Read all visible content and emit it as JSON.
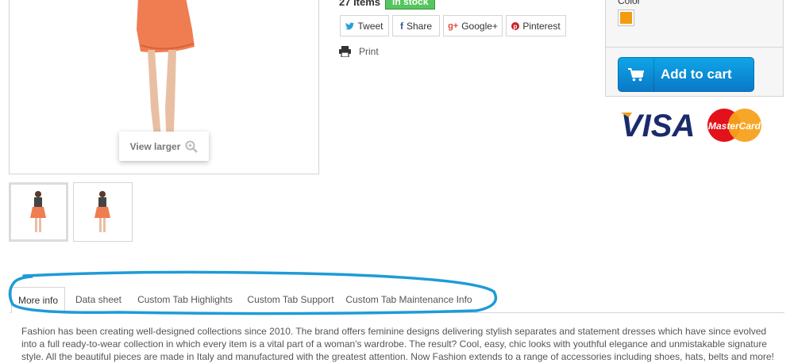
{
  "stock": {
    "quantity_text": "27 Items",
    "status_badge": "In stock"
  },
  "share": {
    "tweet": "Tweet",
    "share": "Share",
    "google": "Google+",
    "pinterest": "Pinterest"
  },
  "print_label": "Print",
  "image": {
    "view_larger": "View larger"
  },
  "buy_box": {
    "color_label": "Color",
    "selected_color": "#f39c11",
    "add_to_cart": "Add to cart",
    "payment_logos": [
      "VISA",
      "MasterCard"
    ]
  },
  "tabs": [
    {
      "label": "More info",
      "active": true
    },
    {
      "label": "Data sheet",
      "active": false
    },
    {
      "label": "Custom Tab Highlights",
      "active": false
    },
    {
      "label": "Custom Tab Support",
      "active": false
    },
    {
      "label": "Custom Tab Maintenance Info",
      "active": false
    }
  ],
  "description": "Fashion has been creating well-designed collections since 2010. The brand offers feminine designs delivering stylish separates and statement dresses which have since evolved into a full ready-to-wear collection in which every item is a vital part of a woman's wardrobe. The result? Cool, easy, chic looks with youthful elegance and unmistakable signature style. All the beautiful pieces are made in Italy and manufactured with the greatest attention. Now Fashion extends to a range of accessories including shoes, hats, belts and more!",
  "colors": {
    "accent_blue": "#0a85d0",
    "stock_green": "#55c65e",
    "annotation": "#1e9bd7"
  }
}
